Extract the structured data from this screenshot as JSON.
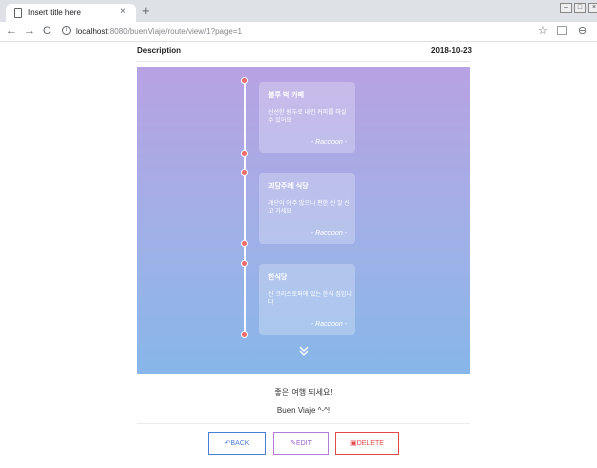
{
  "browser": {
    "tab_title": "Insert title here",
    "tab_close": "×",
    "new_tab": "+",
    "url_host": "localhost",
    "url_rest": ":8080/buenViaje/route/view/1?page=1",
    "nav_back": "←",
    "nav_forward": "→",
    "nav_reload": "C",
    "star": "☆",
    "account": "⊖"
  },
  "page": {
    "title": "Description",
    "date": "2018-10-23",
    "cards": [
      {
        "title": "블루 벅 카페",
        "desc": "신선한 원두로 내린 커피를 마실 수 있어요",
        "author": "- Raccoon -"
      },
      {
        "title": "괴담주례 식당",
        "desc": "개단이 아주 많으나 편한 신 잘 신고 가세요",
        "author": "- Raccoon -"
      },
      {
        "title": "한식당",
        "desc": "신 크리스토퍼에 있는 한식 집입니다",
        "author": "- Raccoon -"
      }
    ],
    "more_icon": "⌄",
    "message": "좋은 여행 되세요!",
    "sign": "Buen Viaje ^-^!",
    "buttons": {
      "back": "BACK",
      "edit": "EDIT",
      "delete": "DELETE"
    }
  }
}
